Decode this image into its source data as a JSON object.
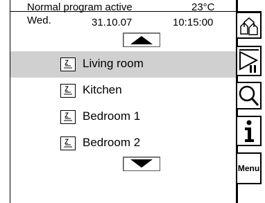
{
  "status": {
    "program": "Normal program active",
    "temperature": "23°C",
    "weekday": "Wed.",
    "date": "31.10.07",
    "time": "10:15:00"
  },
  "rooms": [
    {
      "label": "Living room",
      "selected": true
    },
    {
      "label": "Kitchen",
      "selected": false
    },
    {
      "label": "Bedroom 1",
      "selected": false
    },
    {
      "label": "Bedroom 2",
      "selected": false
    }
  ],
  "sidebar": {
    "menu_label": "Menu",
    "icons": [
      "rooms-overview-icon",
      "play-pause-icon",
      "search-icon",
      "info-icon"
    ]
  },
  "colors": {
    "selected_row": "#d0d0d0",
    "background": "#ffffff"
  }
}
